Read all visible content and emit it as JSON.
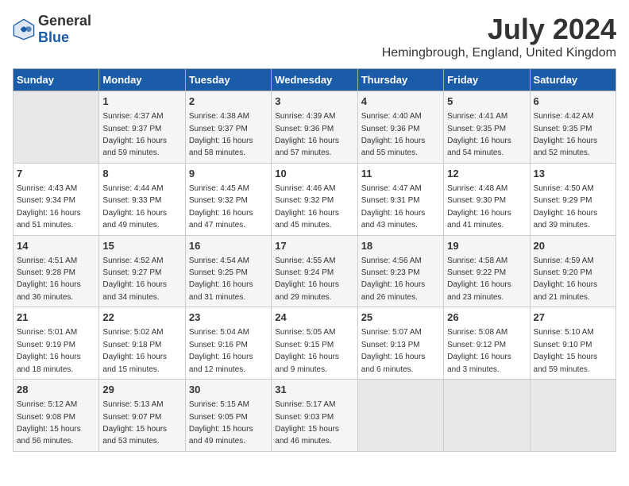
{
  "header": {
    "logo_general": "General",
    "logo_blue": "Blue",
    "month_year": "July 2024",
    "location": "Hemingbrough, England, United Kingdom"
  },
  "days_of_week": [
    "Sunday",
    "Monday",
    "Tuesday",
    "Wednesday",
    "Thursday",
    "Friday",
    "Saturday"
  ],
  "weeks": [
    [
      {
        "day": "",
        "info": ""
      },
      {
        "day": "1",
        "info": "Sunrise: 4:37 AM\nSunset: 9:37 PM\nDaylight: 16 hours and 59 minutes."
      },
      {
        "day": "2",
        "info": "Sunrise: 4:38 AM\nSunset: 9:37 PM\nDaylight: 16 hours and 58 minutes."
      },
      {
        "day": "3",
        "info": "Sunrise: 4:39 AM\nSunset: 9:36 PM\nDaylight: 16 hours and 57 minutes."
      },
      {
        "day": "4",
        "info": "Sunrise: 4:40 AM\nSunset: 9:36 PM\nDaylight: 16 hours and 55 minutes."
      },
      {
        "day": "5",
        "info": "Sunrise: 4:41 AM\nSunset: 9:35 PM\nDaylight: 16 hours and 54 minutes."
      },
      {
        "day": "6",
        "info": "Sunrise: 4:42 AM\nSunset: 9:35 PM\nDaylight: 16 hours and 52 minutes."
      }
    ],
    [
      {
        "day": "7",
        "info": "Sunrise: 4:43 AM\nSunset: 9:34 PM\nDaylight: 16 hours and 51 minutes."
      },
      {
        "day": "8",
        "info": "Sunrise: 4:44 AM\nSunset: 9:33 PM\nDaylight: 16 hours and 49 minutes."
      },
      {
        "day": "9",
        "info": "Sunrise: 4:45 AM\nSunset: 9:32 PM\nDaylight: 16 hours and 47 minutes."
      },
      {
        "day": "10",
        "info": "Sunrise: 4:46 AM\nSunset: 9:32 PM\nDaylight: 16 hours and 45 minutes."
      },
      {
        "day": "11",
        "info": "Sunrise: 4:47 AM\nSunset: 9:31 PM\nDaylight: 16 hours and 43 minutes."
      },
      {
        "day": "12",
        "info": "Sunrise: 4:48 AM\nSunset: 9:30 PM\nDaylight: 16 hours and 41 minutes."
      },
      {
        "day": "13",
        "info": "Sunrise: 4:50 AM\nSunset: 9:29 PM\nDaylight: 16 hours and 39 minutes."
      }
    ],
    [
      {
        "day": "14",
        "info": "Sunrise: 4:51 AM\nSunset: 9:28 PM\nDaylight: 16 hours and 36 minutes."
      },
      {
        "day": "15",
        "info": "Sunrise: 4:52 AM\nSunset: 9:27 PM\nDaylight: 16 hours and 34 minutes."
      },
      {
        "day": "16",
        "info": "Sunrise: 4:54 AM\nSunset: 9:25 PM\nDaylight: 16 hours and 31 minutes."
      },
      {
        "day": "17",
        "info": "Sunrise: 4:55 AM\nSunset: 9:24 PM\nDaylight: 16 hours and 29 minutes."
      },
      {
        "day": "18",
        "info": "Sunrise: 4:56 AM\nSunset: 9:23 PM\nDaylight: 16 hours and 26 minutes."
      },
      {
        "day": "19",
        "info": "Sunrise: 4:58 AM\nSunset: 9:22 PM\nDaylight: 16 hours and 23 minutes."
      },
      {
        "day": "20",
        "info": "Sunrise: 4:59 AM\nSunset: 9:20 PM\nDaylight: 16 hours and 21 minutes."
      }
    ],
    [
      {
        "day": "21",
        "info": "Sunrise: 5:01 AM\nSunset: 9:19 PM\nDaylight: 16 hours and 18 minutes."
      },
      {
        "day": "22",
        "info": "Sunrise: 5:02 AM\nSunset: 9:18 PM\nDaylight: 16 hours and 15 minutes."
      },
      {
        "day": "23",
        "info": "Sunrise: 5:04 AM\nSunset: 9:16 PM\nDaylight: 16 hours and 12 minutes."
      },
      {
        "day": "24",
        "info": "Sunrise: 5:05 AM\nSunset: 9:15 PM\nDaylight: 16 hours and 9 minutes."
      },
      {
        "day": "25",
        "info": "Sunrise: 5:07 AM\nSunset: 9:13 PM\nDaylight: 16 hours and 6 minutes."
      },
      {
        "day": "26",
        "info": "Sunrise: 5:08 AM\nSunset: 9:12 PM\nDaylight: 16 hours and 3 minutes."
      },
      {
        "day": "27",
        "info": "Sunrise: 5:10 AM\nSunset: 9:10 PM\nDaylight: 15 hours and 59 minutes."
      }
    ],
    [
      {
        "day": "28",
        "info": "Sunrise: 5:12 AM\nSunset: 9:08 PM\nDaylight: 15 hours and 56 minutes."
      },
      {
        "day": "29",
        "info": "Sunrise: 5:13 AM\nSunset: 9:07 PM\nDaylight: 15 hours and 53 minutes."
      },
      {
        "day": "30",
        "info": "Sunrise: 5:15 AM\nSunset: 9:05 PM\nDaylight: 15 hours and 49 minutes."
      },
      {
        "day": "31",
        "info": "Sunrise: 5:17 AM\nSunset: 9:03 PM\nDaylight: 15 hours and 46 minutes."
      },
      {
        "day": "",
        "info": ""
      },
      {
        "day": "",
        "info": ""
      },
      {
        "day": "",
        "info": ""
      }
    ]
  ]
}
